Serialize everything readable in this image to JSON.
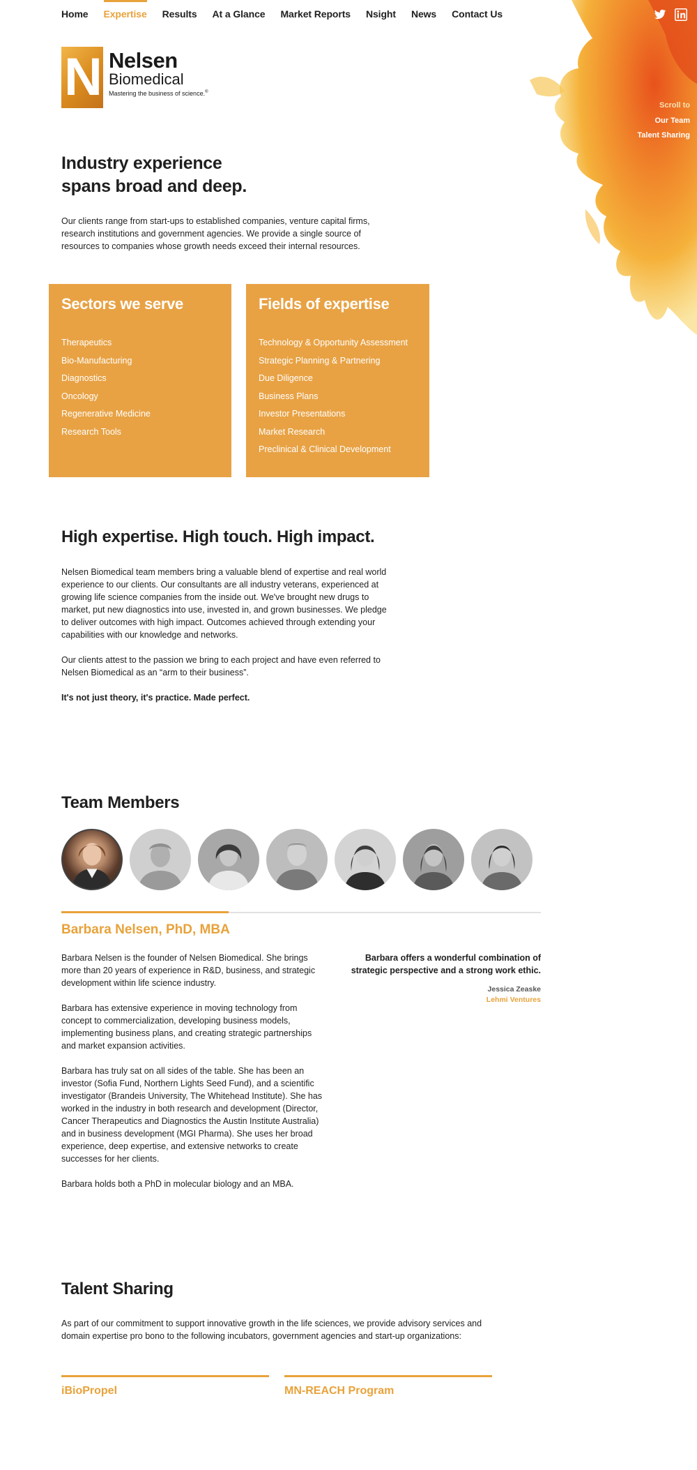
{
  "nav": {
    "items": [
      {
        "label": "Home",
        "active": false
      },
      {
        "label": "Expertise",
        "active": true
      },
      {
        "label": "Results",
        "active": false
      },
      {
        "label": "At a Glance",
        "active": false
      },
      {
        "label": "Market Reports",
        "active": false
      },
      {
        "label": "Nsight",
        "active": false
      },
      {
        "label": "News",
        "active": false
      },
      {
        "label": "Contact Us",
        "active": false
      }
    ],
    "social": [
      "twitter-icon",
      "linkedin-icon"
    ]
  },
  "logo": {
    "mark": "N",
    "name": "Nelsen",
    "sub": "Biomedical",
    "tagline": "Mastering the business of science.",
    "trademark": "®"
  },
  "scroll_to": {
    "label": "Scroll to",
    "links": [
      "Our Team",
      "Talent Sharing"
    ]
  },
  "intro": {
    "heading_line1": "Industry experience",
    "heading_line2": "spans broad and deep.",
    "text": "Our clients range from start-ups to established companies, venture capital firms, research institutions and government agencies.  We provide a single source of resources to companies whose growth needs exceed their internal resources."
  },
  "sectors": {
    "title": "Sectors we serve",
    "items": [
      "Therapeutics",
      "Bio-Manufacturing",
      "Diagnostics",
      "Oncology",
      "Regenerative Medicine",
      "Research Tools"
    ]
  },
  "fields": {
    "title": "Fields of expertise",
    "items": [
      "Technology & Opportunity Assessment",
      "Strategic Planning & Partnering",
      "Due Diligence",
      "Business Plans",
      "Investor Presentations",
      "Market Research",
      "Preclinical & Clinical Development"
    ]
  },
  "impact": {
    "heading": "High expertise. High touch. High impact.",
    "p1": "Nelsen Biomedical team members bring a valuable blend of expertise and real world experience to our clients. Our consultants are all industry veterans, experienced at growing life science companies from the inside out. We've brought new drugs to market, put new diagnostics into use, invested in, and grown businesses. We pledge to deliver outcomes with high impact. Outcomes achieved through extending your capabilities with our knowledge and networks.",
    "p2": "Our clients attest to the passion we bring to each project and have even referred to Nelsen Biomedical as an “arm to their business”.",
    "p3": "It's not just theory, it's practice. Made perfect."
  },
  "team": {
    "heading": "Team Members",
    "member_count": 7,
    "selected": {
      "name": "Barbara Nelsen, PhD, MBA",
      "bio": [
        "Barbara Nelsen is the founder of Nelsen Biomedical. She brings more than 20 years of experience in R&D, business, and strategic development within life science industry.",
        "Barbara has extensive experience in moving technology from concept to commercialization, developing business models, implementing business plans, and creating strategic partnerships and market expansion activities.",
        "Barbara has truly sat on all sides of the table. She has been an investor (Sofia Fund, Northern Lights Seed Fund), and a scientific investigator (Brandeis University, The Whitehead Institute). She has worked in the industry in both research and development (Director, Cancer Therapeutics and Diagnostics the Austin Institute Australia) and in business development (MGI Pharma). She uses her broad experience, deep expertise, and extensive networks to create successes for her clients.",
        "Barbara holds both a PhD in molecular biology and an MBA."
      ],
      "quote": "Barbara offers a wonderful combination of strategic perspective and a strong work ethic.",
      "quote_author": "Jessica Zeaske",
      "quote_org": "Lehmi Ventures"
    }
  },
  "talent": {
    "heading": "Talent Sharing",
    "text": "As part of our commitment to support innovative growth in the life sciences, we provide advisory services and domain expertise pro bono to the following incubators, government agencies and start-up organizations:",
    "orgs": [
      "iBioPropel",
      "MN-REACH Program"
    ]
  },
  "colors": {
    "accent": "#e8a23a",
    "box": "#e8a244",
    "text": "#1f1f1f"
  }
}
